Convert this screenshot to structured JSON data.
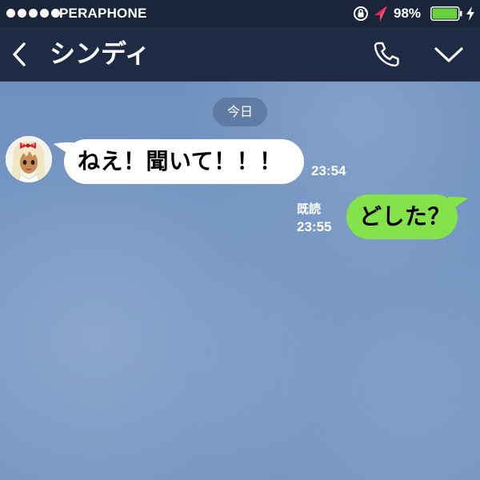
{
  "status_bar": {
    "carrier": "PERAPHONE",
    "battery_percent": "98%",
    "signal_bars": 5,
    "battery_level": 0.98,
    "icons": [
      "signal-dots-icon",
      "lock-rotation-icon",
      "location-icon",
      "battery-icon",
      "charging-icon"
    ]
  },
  "header": {
    "contact_name": "シンディ",
    "icons": [
      "back-arrow-icon",
      "phone-icon",
      "chevron-down-icon"
    ]
  },
  "chat": {
    "date_label": "今日",
    "background_color": "#7193c1",
    "messages": [
      {
        "direction": "incoming",
        "text": "ねえ！聞いて！！！",
        "time": "23:54",
        "bubble_color": "#ffffff"
      },
      {
        "direction": "outgoing",
        "text": "どした？",
        "time": "23:55",
        "read_label": "既読",
        "bubble_color": "#84e34a"
      }
    ]
  },
  "colors": {
    "status_bar": "#1b2539",
    "header": "#1f2b45",
    "battery_fill": "#6ad03e",
    "location_arrow": "#ee2255"
  }
}
